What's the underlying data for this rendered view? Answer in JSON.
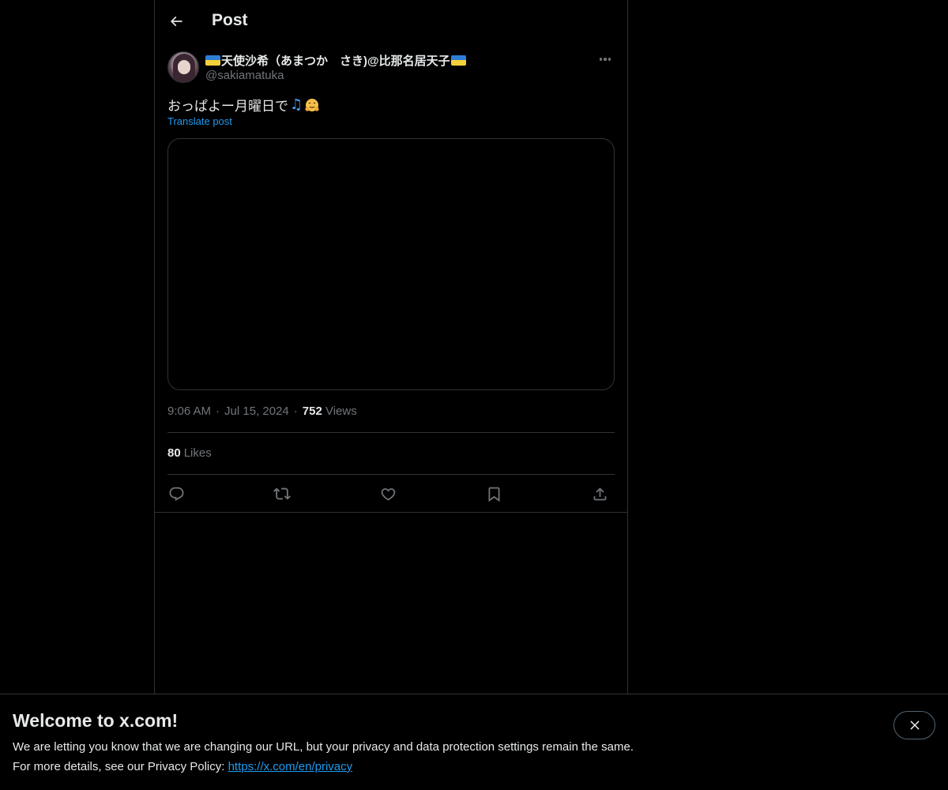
{
  "topbar": {
    "title": "Post"
  },
  "author": {
    "display_name": "天使沙希（あまつか　さき)@比那名居天子",
    "handle": "@sakiamatuka"
  },
  "post": {
    "text": "おっぱよー月曜日で",
    "translate_label": "Translate post"
  },
  "meta": {
    "time": "9:06 AM",
    "dot": "·",
    "date": "Jul 15, 2024",
    "views_count": "752",
    "views_label": "Views"
  },
  "likes": {
    "count": "80",
    "label": "Likes"
  },
  "banner": {
    "title": "Welcome to x.com!",
    "line1": "We are letting you know that we are changing our URL, but your privacy and data protection settings remain the same.",
    "line2_prefix": "For more details, see our Privacy Policy: ",
    "link": "https://x.com/en/privacy"
  },
  "colors": {
    "accent": "#1d9bf0",
    "muted": "#71767b",
    "border": "#2f3336",
    "background": "#000000"
  },
  "icons": [
    "back-arrow-icon",
    "more-icon",
    "reply-icon",
    "repost-icon",
    "like-icon",
    "bookmark-icon",
    "share-icon",
    "close-icon",
    "music-note-emoji",
    "hugging-face-emoji",
    "ukraine-flag-emoji"
  ]
}
